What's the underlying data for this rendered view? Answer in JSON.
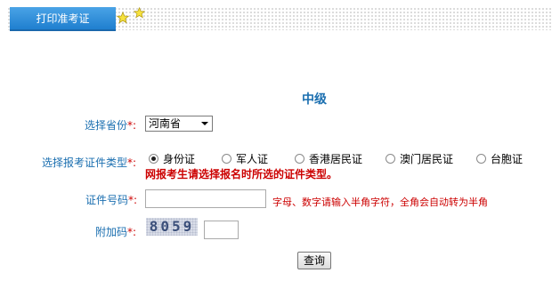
{
  "header": {
    "tab_label": "打印准考证"
  },
  "form": {
    "level_title": "中级",
    "province": {
      "label": "选择省份",
      "required_mark": "*:",
      "selected": "河南省"
    },
    "id_type": {
      "label": "选择报考证件类型",
      "required_mark": "*:",
      "options": [
        "身份证",
        "军人证",
        "香港居民证",
        "澳门居民证",
        "台胞证"
      ],
      "selected": "身份证",
      "warning": "网报考生请选择报名时所选的证件类型。"
    },
    "id_number": {
      "label": "证件号码",
      "required_mark": "*:",
      "value": "",
      "hint": "字母、数字请输入半角字符，全角会自动转为半角"
    },
    "captcha": {
      "label": "附加码",
      "required_mark": "*:",
      "image_text": "8059",
      "value": ""
    },
    "submit_label": "查询"
  }
}
